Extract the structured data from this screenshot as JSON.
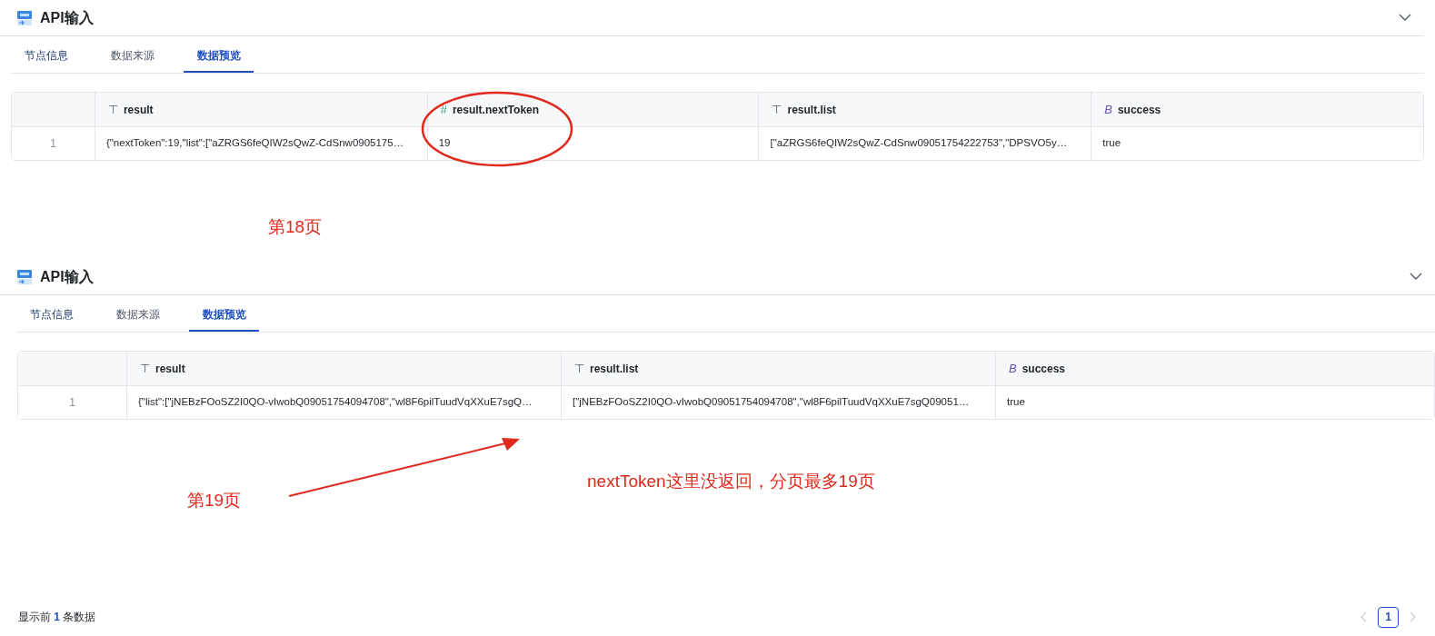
{
  "panels": [
    {
      "title": "API输入",
      "tabs": [
        {
          "label": "节点信息",
          "selected": false
        },
        {
          "label": "数据来源",
          "selected": false
        },
        {
          "label": "数据预览",
          "selected": true
        }
      ],
      "table": {
        "columns": [
          {
            "type_mark": "⊤",
            "kind": "string",
            "label": "result"
          },
          {
            "type_mark": "#",
            "kind": "number",
            "label": "result.nextToken"
          },
          {
            "type_mark": "⊤",
            "kind": "string",
            "label": "result.list"
          },
          {
            "type_mark": "B",
            "kind": "boolean",
            "label": "success"
          }
        ],
        "rows": [
          {
            "index": "1",
            "cells": [
              "{\"nextToken\":19,\"list\":[\"aZRGS6feQIW2sQwZ-CdSnw0905175…",
              "19",
              "[\"aZRGS6feQIW2sQwZ-CdSnw09051754222753\",\"DPSVO5y…",
              "true"
            ]
          }
        ]
      }
    },
    {
      "title": "API输入",
      "tabs": [
        {
          "label": "节点信息",
          "selected": false
        },
        {
          "label": "数据来源",
          "selected": false
        },
        {
          "label": "数据预览",
          "selected": true
        }
      ],
      "table": {
        "columns": [
          {
            "type_mark": "⊤",
            "kind": "string",
            "label": "result"
          },
          {
            "type_mark": "⊤",
            "kind": "string",
            "label": "result.list"
          },
          {
            "type_mark": "B",
            "kind": "boolean",
            "label": "success"
          }
        ],
        "rows": [
          {
            "index": "1",
            "cells": [
              "{\"list\":[\"jNEBzFOoSZ2I0QO-vIwobQ09051754094708\",\"wl8F6pilTuudVqXXuE7sgQ…",
              "[\"jNEBzFOoSZ2I0QO-vIwobQ09051754094708\",\"wl8F6pilTuudVqXXuE7sgQ09051…",
              "true"
            ]
          }
        ]
      }
    }
  ],
  "annotations": [
    {
      "kind": "ellipse"
    },
    {
      "kind": "label",
      "text": "第18页"
    },
    {
      "kind": "arrow"
    },
    {
      "kind": "label",
      "text": "nextToken这里没返回，分页最多19页"
    },
    {
      "kind": "label",
      "text": "第19页"
    }
  ],
  "footer": {
    "before": "显示前",
    "count": "1",
    "after": "条数据"
  },
  "pagination": {
    "pages": [
      {
        "label": "1",
        "selected": true
      }
    ]
  }
}
